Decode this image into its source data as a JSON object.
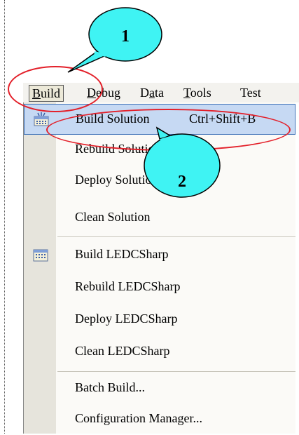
{
  "menubar": {
    "items": [
      {
        "label": "Build",
        "mnemonic": "B",
        "rest": "uild"
      },
      {
        "label": "Debug",
        "mnemonic": "D",
        "rest": "ebug"
      },
      {
        "label": "Data",
        "mnemonic": "a",
        "pre": "D",
        "rest": "ta"
      },
      {
        "label": "Tools",
        "mnemonic": "T",
        "rest": "ools"
      },
      {
        "label": "Test"
      }
    ]
  },
  "menu": {
    "items": [
      {
        "label": "Build Solution",
        "shortcut": "Ctrl+Shift+B",
        "icon": "build-solution-icon",
        "highlighted": true
      },
      {
        "label": "Rebuild Solution"
      },
      {
        "label": "Deploy Solution"
      },
      {
        "label": "Clean Solution"
      },
      {
        "label": "Build LEDCSharp",
        "icon": "build-project-icon"
      },
      {
        "label": "Rebuild LEDCSharp"
      },
      {
        "label": "Deploy LEDCSharp"
      },
      {
        "label": "Clean LEDCSharp"
      },
      {
        "label": "Batch Build..."
      },
      {
        "label": "Configuration Manager..."
      }
    ]
  },
  "callouts": [
    {
      "number": "1"
    },
    {
      "number": "2"
    }
  ],
  "colors": {
    "highlight_ellipse": "#e3202a",
    "callout_fill": "#3ff3f3",
    "selection": "#c6d9f3"
  }
}
